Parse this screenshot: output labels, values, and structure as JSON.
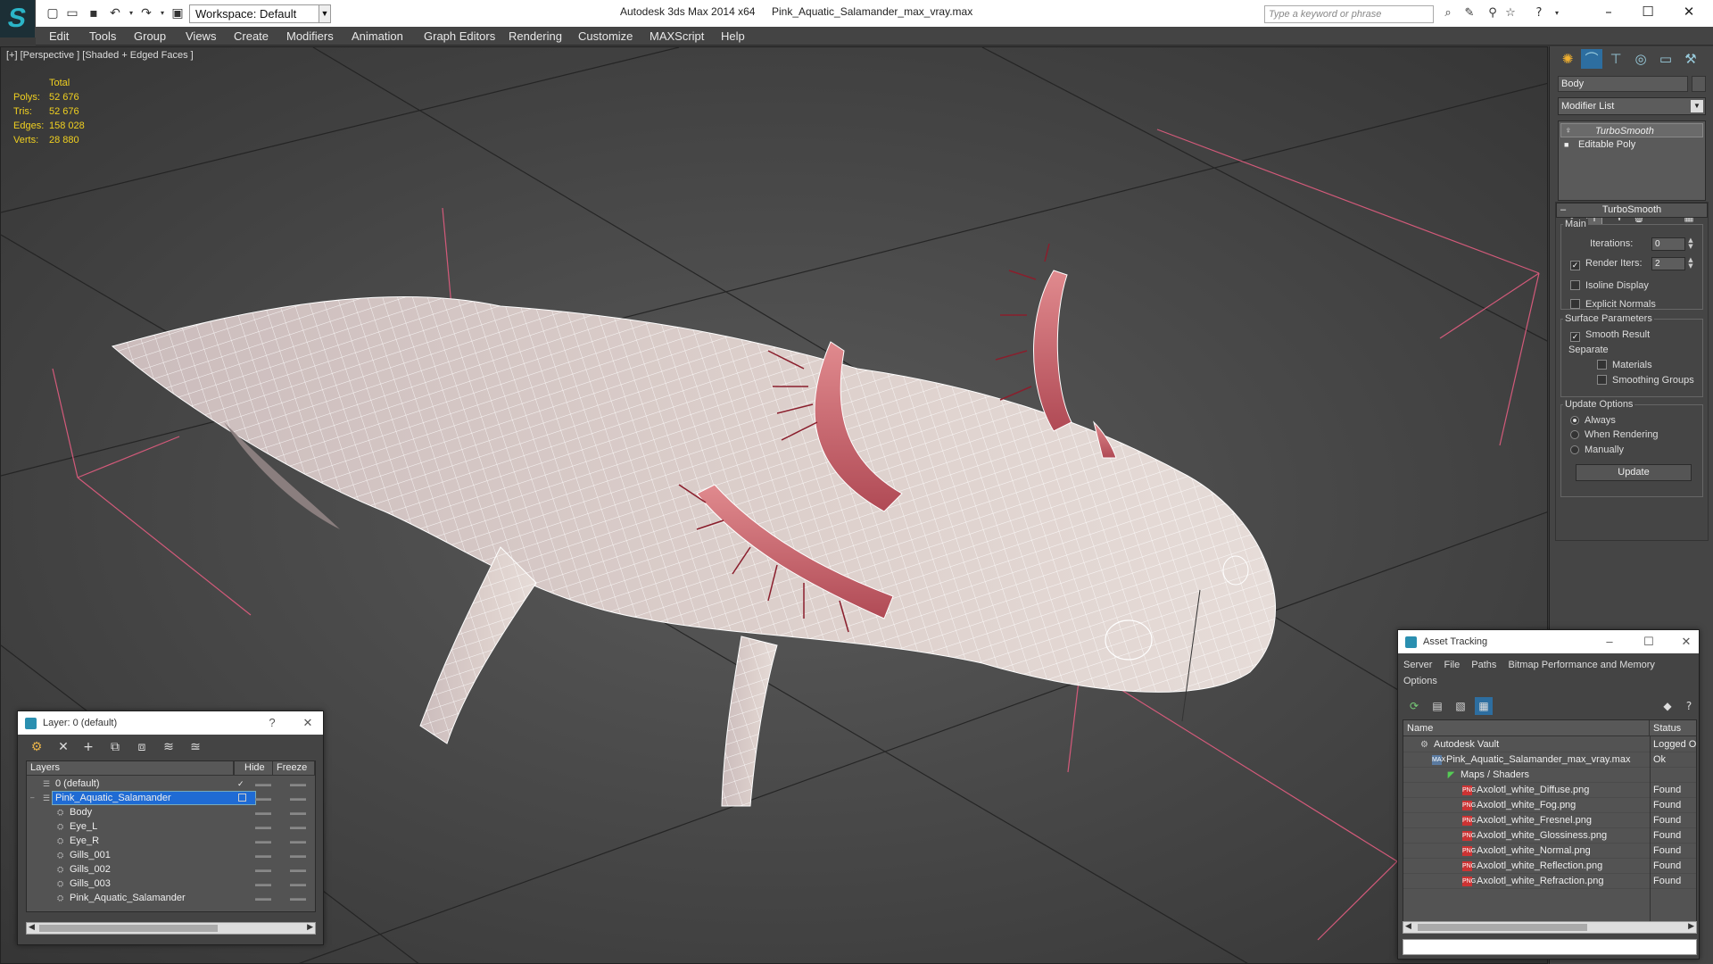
{
  "titlebar": {
    "workspace_label": "Workspace: Default",
    "app_title": "Autodesk 3ds Max  2014 x64",
    "file_title": "Pink_Aquatic_Salamander_max_vray.max",
    "search_placeholder": "Type a keyword or phrase"
  },
  "menu": [
    "Edit",
    "Tools",
    "Group",
    "Views",
    "Create",
    "Modifiers",
    "Animation",
    "Graph Editors",
    "Rendering",
    "Customize",
    "MAXScript",
    "Help"
  ],
  "viewport": {
    "label": "[+] [Perspective ] [Shaded + Edged Faces ]",
    "stats_header": "Total",
    "stats": [
      {
        "label": "Polys:",
        "value": "52 676"
      },
      {
        "label": "Tris:",
        "value": "52 676"
      },
      {
        "label": "Edges:",
        "value": "158 028"
      },
      {
        "label": "Verts:",
        "value": "28 880"
      }
    ]
  },
  "command_panel": {
    "object_name": "Body",
    "modifier_list": "Modifier List",
    "stack": [
      "TurboSmooth",
      "Editable Poly"
    ],
    "rollout_title": "TurboSmooth",
    "main_group": "Main",
    "iterations_label": "Iterations:",
    "iterations_value": "0",
    "render_iters_label": "Render Iters:",
    "render_iters_value": "2",
    "isoline_label": "Isoline Display",
    "explicit_normals_label": "Explicit Normals",
    "surface_group": "Surface Parameters",
    "smooth_result_label": "Smooth Result",
    "separate_label": "Separate",
    "materials_label": "Materials",
    "smoothing_groups_label": "Smoothing Groups",
    "update_group": "Update Options",
    "always_label": "Always",
    "when_rendering_label": "When Rendering",
    "manually_label": "Manually",
    "update_button": "Update"
  },
  "layer_panel": {
    "title": "Layer: 0 (default)",
    "help": "?",
    "col_layers": "Layers",
    "col_hide": "Hide",
    "col_freeze": "Freeze",
    "rows": [
      {
        "name": "0 (default)"
      },
      {
        "name": "Pink_Aquatic_Salamander"
      },
      {
        "name": "Body"
      },
      {
        "name": "Eye_L"
      },
      {
        "name": "Eye_R"
      },
      {
        "name": "Gills_001"
      },
      {
        "name": "Gills_002"
      },
      {
        "name": "Gills_003"
      },
      {
        "name": "Pink_Aquatic_Salamander"
      }
    ]
  },
  "asset_panel": {
    "title": "Asset Tracking",
    "menu": [
      "Server",
      "File",
      "Paths",
      "Bitmap Performance and Memory",
      "Options"
    ],
    "col_name": "Name",
    "col_status": "Status",
    "rows": [
      {
        "name": "Autodesk Vault",
        "status": "Logged Out"
      },
      {
        "name": "Pink_Aquatic_Salamander_max_vray.max",
        "status": "Ok"
      },
      {
        "name": "Maps / Shaders",
        "status": ""
      },
      {
        "name": "Axolotl_white_Diffuse.png",
        "status": "Found"
      },
      {
        "name": "Axolotl_white_Fog.png",
        "status": "Found"
      },
      {
        "name": "Axolotl_white_Fresnel.png",
        "status": "Found"
      },
      {
        "name": "Axolotl_white_Glossiness.png",
        "status": "Found"
      },
      {
        "name": "Axolotl_white_Normal.png",
        "status": "Found"
      },
      {
        "name": "Axolotl_white_Reflection.png",
        "status": "Found"
      },
      {
        "name": "Axolotl_white_Refraction.png",
        "status": "Found"
      }
    ]
  }
}
